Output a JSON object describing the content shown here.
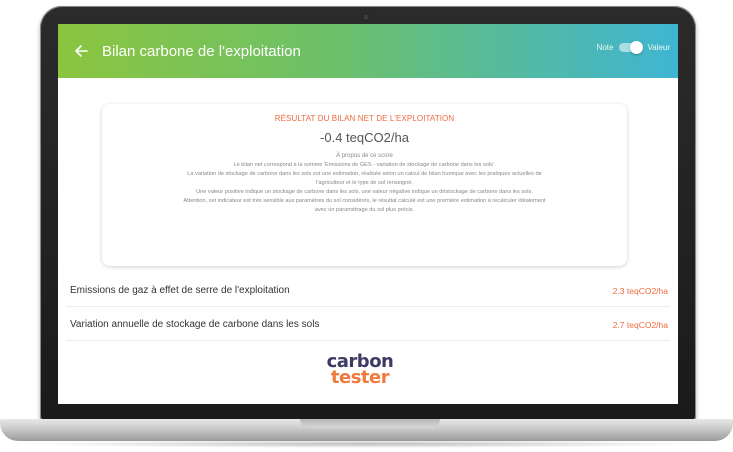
{
  "header": {
    "title": "Bilan carbone de l'exploitation",
    "toggle_left_label": "Note",
    "toggle_right_label": "Valeur",
    "back_icon": "arrow-left-icon"
  },
  "result_card": {
    "heading": "RÉSULTAT DU BILAN NET DE L'EXPLOITATION",
    "score": "-0.4 teqCO2/ha",
    "about": "À propos de ce score",
    "lines": [
      "Le bilan net correspond à la somme 'Emissions de GES - variation de stockage de carbone dans les sols'.",
      "La variation de stockage de carbone dans les sols est une estimation, réalisée selon un calcul de bilan humique avec les pratiques actuelles de",
      "l'agriculteur et le type de sol renseigné.",
      "Une valeur positive indique un stockage de carbone dans les sols, une valeur négative indique un déstockage de carbone dans les sols.",
      "Attention, cet indicateur est très sensible aux paramètres du sol considérés, le résultat calculé est une première estimation à recalculer idéalement",
      "avec un paramétrage du sol plus précis."
    ]
  },
  "rows": [
    {
      "label": "Emissions de gaz à effet de serre de l'exploitation",
      "value": "2.3 teqCO2/ha"
    },
    {
      "label": "Variation annuelle de stockage de carbone dans les sols",
      "value": "2.7 teqCO2/ha"
    }
  ],
  "logo": {
    "line1": "carbon",
    "line2": "tester"
  },
  "colors": {
    "accent": "#ef6a3c",
    "gradient_start": "#8bc53f",
    "gradient_end": "#3fb5d3",
    "logo_dark": "#3d3a63"
  }
}
